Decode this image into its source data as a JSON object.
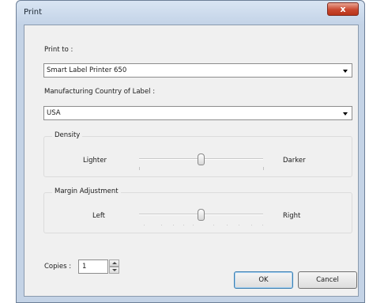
{
  "window": {
    "title": "Print",
    "close_glyph": "x"
  },
  "print_to": {
    "label": "Print to :",
    "value": "Smart Label Printer 650"
  },
  "manufacturing": {
    "label": "Manufacturing Country of Label :",
    "value": "USA"
  },
  "density": {
    "title": "Density",
    "min_label": "Lighter",
    "max_label": "Darker",
    "level": 0.5
  },
  "margin": {
    "title": "Margin Adjustment",
    "min_label": "Left",
    "max_label": "Right",
    "level": 0.5
  },
  "copies": {
    "label": "Copies :",
    "value": "1"
  },
  "buttons": {
    "ok": "OK",
    "cancel": "Cancel"
  },
  "colors": {
    "frame": "#c4d3e6",
    "client": "#f0f0f0",
    "close": "#c94830",
    "default_button_border": "#3c7fb1"
  }
}
